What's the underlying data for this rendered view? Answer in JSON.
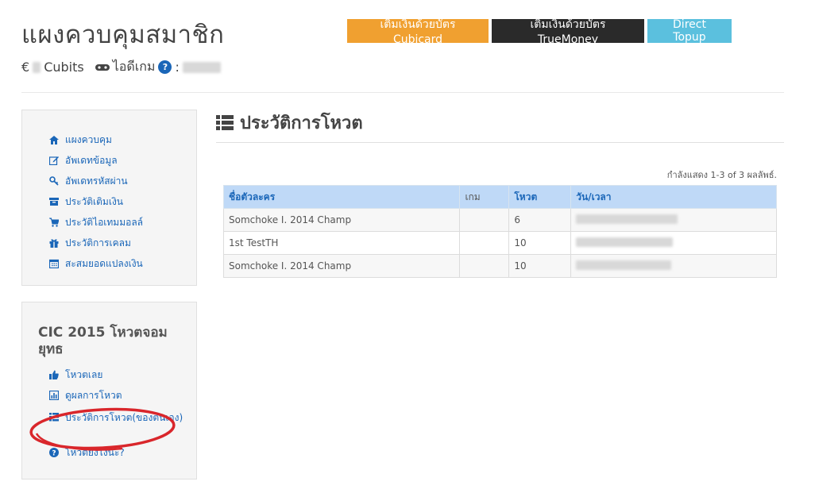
{
  "header": {
    "title": "แผงควบคุมสมาชิก",
    "currency_symbol": "€",
    "cubits_label": "Cubits",
    "game_id_label": "ไอดีเกม",
    "help_badge": "?",
    "colon": ":"
  },
  "topbar": {
    "cubicard_label": "เติมเงินด้วยบัตร Cubicard",
    "truemoney_label": "เติมเงินด้วยบัตร TrueMoney",
    "direct_label": "Direct Topup"
  },
  "sidebar": {
    "items": [
      {
        "label": "แผงควบคุม",
        "icon": "home-icon"
      },
      {
        "label": "อัพเดทข้อมูล",
        "icon": "edit-icon"
      },
      {
        "label": "อัพเดทรหัสผ่าน",
        "icon": "key-icon"
      },
      {
        "label": "ประวัติเติมเงิน",
        "icon": "archive-icon"
      },
      {
        "label": "ประวัติไอเทมมอลล์",
        "icon": "cart-icon"
      },
      {
        "label": "ประวัติการเคลม",
        "icon": "gift-icon"
      },
      {
        "label": "สะสมยอดแปลงเงิน",
        "icon": "calendar-icon"
      }
    ]
  },
  "cic_panel": {
    "title": "CIC 2015 โหวตจอมยุทธ",
    "items": [
      {
        "label": "โหวตเลย",
        "icon": "thumbs-up-icon"
      },
      {
        "label": "ดูผลการโหวต",
        "icon": "bar-chart-icon"
      },
      {
        "label": "ประวัติการโหวต(ของตนเอง)",
        "icon": "list-icon"
      },
      {
        "label": "โหวตยังไงนะ?",
        "icon": "question-icon"
      }
    ]
  },
  "main": {
    "title": "ประวัติการโหวต",
    "results_info": "กำลังแสดง 1-3 of 3 ผลลัพธ์.",
    "columns": [
      "ชื่อตัวละคร",
      "เกม",
      "โหวต",
      "วัน/เวลา"
    ],
    "rows": [
      {
        "name": "Somchoke I. 2014 Champ",
        "game": "",
        "votes": "6"
      },
      {
        "name": "1st TestTH",
        "game": "",
        "votes": "10"
      },
      {
        "name": "Somchoke I. 2014 Champ",
        "game": "",
        "votes": "10"
      }
    ]
  },
  "colors": {
    "accent": "#1a66b8",
    "cubicard_btn": "#f0a030",
    "truemoney_btn": "#2a2a2a",
    "direct_btn": "#5bc0de",
    "table_header": "#bfd9f7",
    "annotation_ellipse": "#d9262b"
  }
}
